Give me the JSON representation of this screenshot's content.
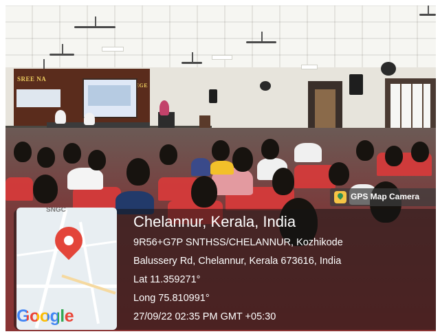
{
  "photo": {
    "banner_left": "SREE NA",
    "banner_right": "COLLEGE"
  },
  "overlay": {
    "app_badge": "GPS Map Camera",
    "map_caption": "SNGC",
    "map_logo": "Google",
    "location_title": "Chelannur, Kerala, India",
    "address_line1": "9R56+G7P SNTHSS/CHELANNUR, Kozhikode",
    "address_line2": "Balussery Rd, Chelannur, Kerala 673616, India",
    "latitude": "Lat 11.359271°",
    "longitude": "Long 75.810991°",
    "timestamp": "27/09/22 02:35 PM GMT +05:30"
  },
  "icons": {
    "pin": "map-pin-icon",
    "app": "gps-map-camera-icon"
  },
  "colors": {
    "pin": "#e3453a",
    "google_blue": "#4285f4",
    "google_red": "#ea4335",
    "google_yellow": "#fbbc05",
    "google_green": "#34a853",
    "chairs": "#d93a3a"
  }
}
